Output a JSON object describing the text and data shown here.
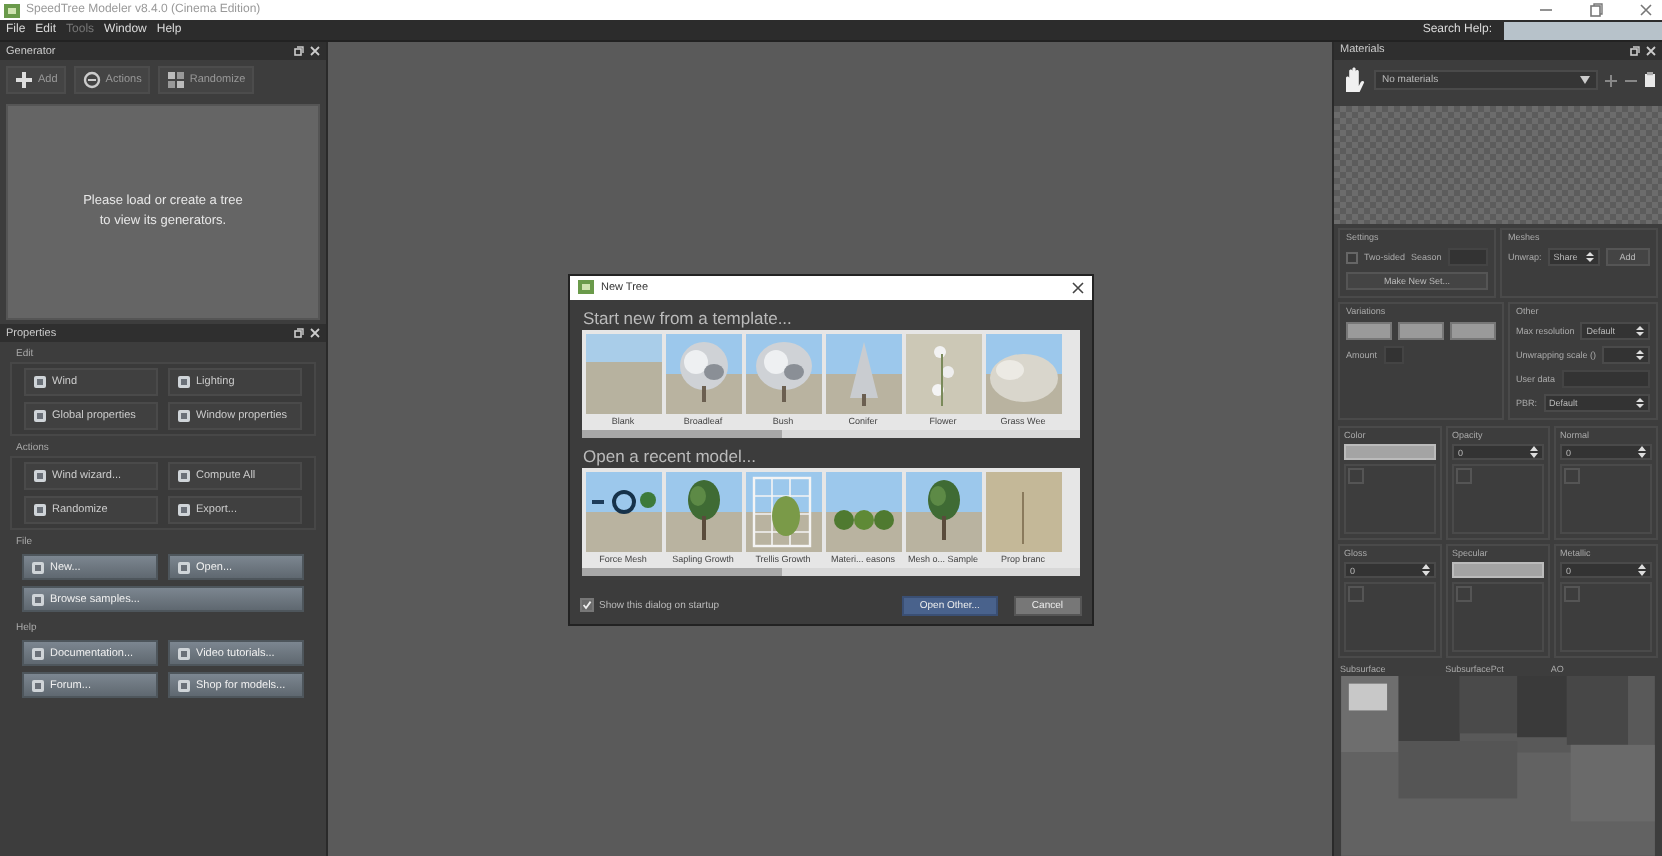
{
  "window": {
    "title": "SpeedTree Modeler v8.4.0 (Cinema Edition)"
  },
  "menu": [
    {
      "label": "File",
      "disabled": false
    },
    {
      "label": "Edit",
      "disabled": false
    },
    {
      "label": "Tools",
      "disabled": true
    },
    {
      "label": "Window",
      "disabled": false
    },
    {
      "label": "Help",
      "disabled": false
    }
  ],
  "search_help": {
    "label": "Search Help:"
  },
  "generator": {
    "title": "Generator",
    "tools": [
      "Add",
      "Actions",
      "Randomize"
    ],
    "message": "Please load or create a tree\nto view its generators."
  },
  "properties": {
    "title": "Properties",
    "groups": [
      {
        "title": "Edit",
        "kind": "flat",
        "buttons": [
          {
            "label": "Wind",
            "wide": false
          },
          {
            "label": "Lighting",
            "wide": false
          },
          {
            "label": "Global properties",
            "wide": false
          },
          {
            "label": "Window properties",
            "wide": false
          }
        ]
      },
      {
        "title": "Actions",
        "kind": "flat",
        "buttons": [
          {
            "label": "Wind wizard...",
            "wide": false
          },
          {
            "label": "Compute All",
            "wide": false
          },
          {
            "label": "Randomize",
            "wide": false
          },
          {
            "label": "Export...",
            "wide": false
          }
        ]
      },
      {
        "title": "File",
        "kind": "raised",
        "buttons": [
          {
            "label": "New...",
            "wide": false
          },
          {
            "label": "Open...",
            "wide": false
          },
          {
            "label": "Browse samples...",
            "wide": true
          }
        ]
      },
      {
        "title": "Help",
        "kind": "raised",
        "buttons": [
          {
            "label": "Documentation...",
            "wide": false
          },
          {
            "label": "Video tutorials...",
            "wide": false
          },
          {
            "label": "Forum...",
            "wide": false
          },
          {
            "label": "Shop for models...",
            "wide": false
          }
        ]
      }
    ]
  },
  "dialog": {
    "title": "New Tree",
    "sections": [
      {
        "heading": "Start new from a template...",
        "items": [
          {
            "label": "Blank"
          },
          {
            "label": "Broadleaf"
          },
          {
            "label": "Bush"
          },
          {
            "label": "Conifer"
          },
          {
            "label": "Flower"
          },
          {
            "label": "Grass Wee"
          }
        ]
      },
      {
        "heading": "Open a recent model...",
        "items": [
          {
            "label": "Force Mesh"
          },
          {
            "label": "Sapling Growth"
          },
          {
            "label": "Trellis Growth"
          },
          {
            "label": "Materi... easons"
          },
          {
            "label": "Mesh o... Sample"
          },
          {
            "label": "Prop branc"
          }
        ]
      }
    ],
    "show_on_startup": {
      "label": "Show this dialog on startup",
      "checked": true
    },
    "buttons": [
      {
        "label": "Open Other...",
        "kind": "primary"
      },
      {
        "label": "Cancel",
        "kind": "secondary"
      }
    ]
  },
  "materials": {
    "title": "Materials",
    "selector": {
      "value": "No materials"
    },
    "settings": {
      "title": "Settings",
      "two_sided": {
        "label": "Two-sided",
        "checked": false
      },
      "season_label": "Season",
      "button": "Make New Set..."
    },
    "meshes": {
      "title": "Meshes",
      "unwrap_label": "Unwrap:",
      "unwrap_value": "Share",
      "button": "Add"
    },
    "variations": {
      "title": "Variations",
      "amount_label": "Amount"
    },
    "other": {
      "title": "Other",
      "rows": [
        {
          "label": "Max resolution",
          "value": "Default",
          "kind": "select"
        },
        {
          "label": "Unwrapping scale ()",
          "kind": "spin"
        },
        {
          "label": "User data",
          "kind": "text"
        },
        {
          "label": "PBR:",
          "value": "Default",
          "kind": "select"
        }
      ]
    },
    "maps": [
      {
        "label": "Color",
        "kind": "swatch"
      },
      {
        "label": "Opacity",
        "kind": "number",
        "value": "0"
      },
      {
        "label": "Normal",
        "kind": "number",
        "value": "0"
      },
      {
        "label": "Gloss",
        "kind": "number",
        "value": "0"
      },
      {
        "label": "Specular",
        "kind": "swatch"
      },
      {
        "label": "Metallic",
        "kind": "number",
        "value": "0"
      }
    ],
    "subsurface_labels": [
      "Subsurface",
      "SubsurfacePct",
      "AO"
    ]
  }
}
